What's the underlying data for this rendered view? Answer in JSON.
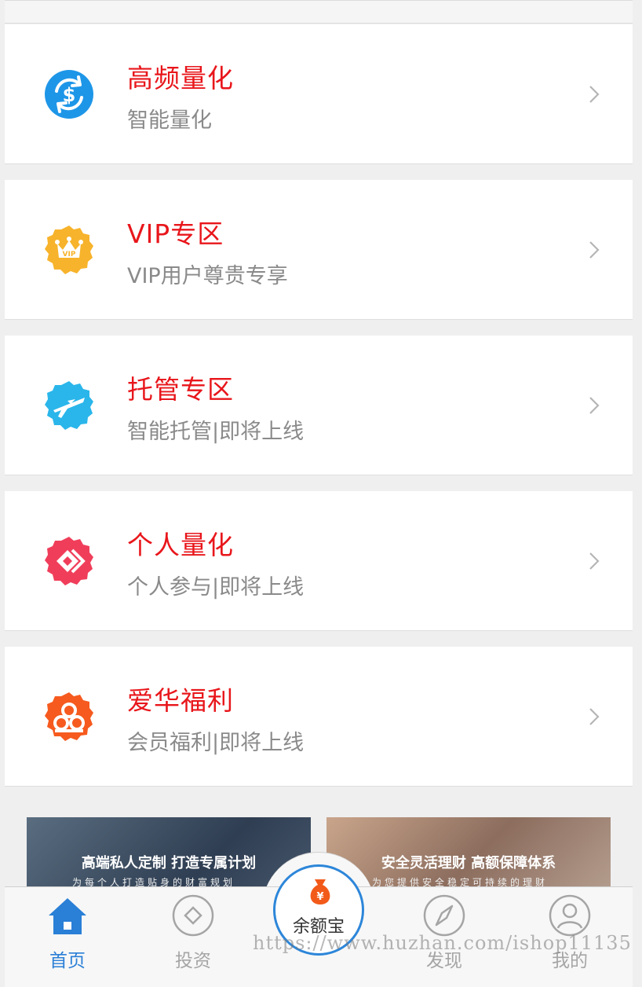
{
  "cards": [
    {
      "title": "高频量化",
      "subtitle": "智能量化",
      "icon": "dollar-exchange-icon",
      "color": "#1e96e8"
    },
    {
      "title": "VIP专区",
      "subtitle": "VIP用户尊贵专享",
      "icon": "vip-crown-icon",
      "color": "#f7b32b"
    },
    {
      "title": "托管专区",
      "subtitle": "智能托管|即将上线",
      "icon": "airplane-icon",
      "color": "#2ab6ea"
    },
    {
      "title": "个人量化",
      "subtitle": "个人参与|即将上线",
      "icon": "arrow-diamond-icon",
      "color": "#f03e5a"
    },
    {
      "title": "爱华福利",
      "subtitle": "会员福利|即将上线",
      "icon": "flower-icon",
      "color": "#f65a1e"
    }
  ],
  "banners": [
    {
      "title": "高端私人定制 打造专属计划",
      "subtitle": "为每个人打造贴身的财富规划"
    },
    {
      "title": "安全灵活理财 高额保障体系",
      "subtitle": "为您提供安全稳定可持续的理财"
    }
  ],
  "tabbar": {
    "home": "首页",
    "invest": "投资",
    "center": "余额宝",
    "discover": "发现",
    "mine": "我的"
  },
  "watermark": "https://www.huzhan.com/ishop11135",
  "colors": {
    "title_red": "#e8161b",
    "active_blue": "#2a7fd6",
    "inactive": "#a5a5a5"
  }
}
